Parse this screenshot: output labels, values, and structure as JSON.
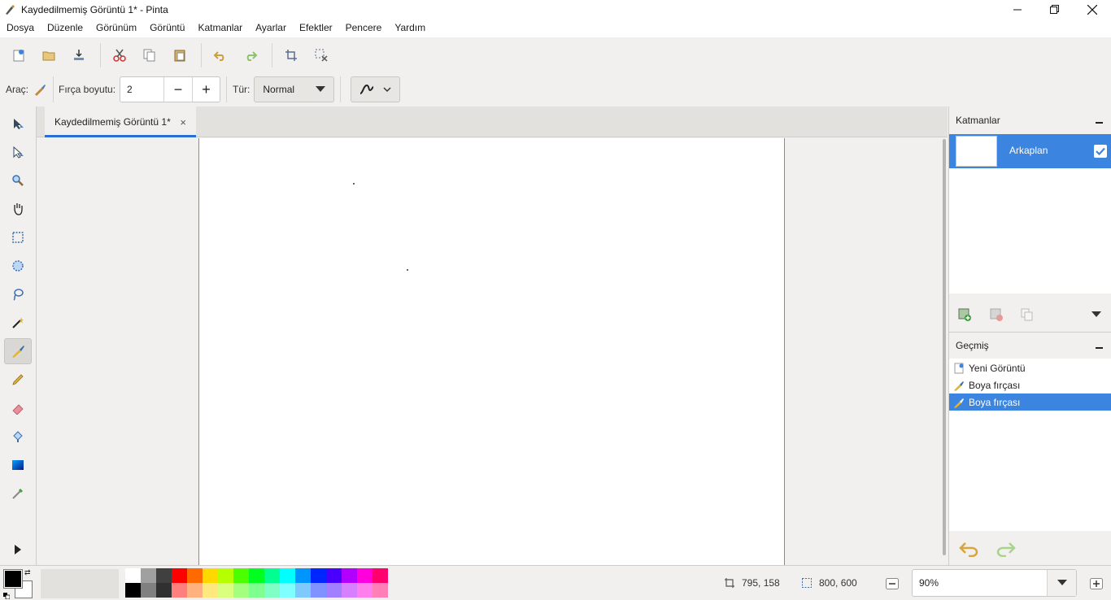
{
  "window": {
    "title": "Kaydedilmemiş Görüntü 1* - Pinta",
    "icons": [
      "paintbrush-icon",
      "minimize-icon",
      "restore-icon",
      "close-icon"
    ]
  },
  "menu": [
    "Dosya",
    "Düzenle",
    "Görünüm",
    "Görüntü",
    "Katmanlar",
    "Ayarlar",
    "Efektler",
    "Pencere",
    "Yardım"
  ],
  "toolbar_icons": [
    "new-image-icon",
    "open-icon",
    "save-icon",
    "cut-icon",
    "copy-icon",
    "paste-icon",
    "undo-icon",
    "redo-icon",
    "crop-to-selection-icon",
    "deselect-icon"
  ],
  "tool_options": {
    "tool_label": "Araç:",
    "brush_size_label": "Fırça boyutu:",
    "brush_size_value": "2",
    "type_label": "Tür:",
    "type_value": "Normal",
    "minus": "−",
    "plus": "+"
  },
  "tools": {
    "names": [
      "move-selected-icon",
      "move-selection-icon",
      "zoom-icon",
      "pan-icon",
      "rectangle-select-icon",
      "ellipse-select-icon",
      "lasso-select-icon",
      "magic-wand-icon",
      "paintbrush-icon",
      "pencil-icon",
      "eraser-icon",
      "paint-bucket-icon",
      "gradient-icon",
      "color-picker-icon",
      "more-tools-icon"
    ],
    "active": "paintbrush-icon"
  },
  "document": {
    "tab_title": "Kaydedilmemiş Görüntü 1*",
    "tab_close": "×"
  },
  "layers": {
    "title": "Katmanlar",
    "items": [
      {
        "name": "Arkaplan",
        "visible": true,
        "selected": true
      }
    ]
  },
  "history": {
    "title": "Geçmiş",
    "items": [
      {
        "label": "Yeni Görüntü",
        "icon": "new-image-icon",
        "selected": false
      },
      {
        "label": "Boya fırçası",
        "icon": "paintbrush-icon",
        "selected": false
      },
      {
        "label": "Boya fırçası",
        "icon": "paintbrush-icon",
        "selected": true
      }
    ]
  },
  "status": {
    "cursor_position": "795, 158",
    "selection_size": "800, 600",
    "zoom": "90%"
  },
  "colors": {
    "primary": "#000000",
    "secondary": "#ffffff",
    "accent": "#3b84e0",
    "palette_top": [
      "#ffffff",
      "#a0a0a0",
      "#404040",
      "#ff0000",
      "#ff6a00",
      "#ffd800",
      "#b6ff00",
      "#4cff00",
      "#00ff21",
      "#00ff90",
      "#00ffff",
      "#0094ff",
      "#0026ff",
      "#4800ff",
      "#b200ff",
      "#ff00dc",
      "#ff006e"
    ],
    "palette_bottom": [
      "#000000",
      "#808080",
      "#303030",
      "#ff7f7f",
      "#ffb27f",
      "#ffe97f",
      "#daff7f",
      "#a5ff7f",
      "#7fff8e",
      "#7fffc5",
      "#7fffff",
      "#7fc9ff",
      "#7f92ff",
      "#a17fff",
      "#d67fff",
      "#ff7fed",
      "#ff7fb6"
    ]
  }
}
